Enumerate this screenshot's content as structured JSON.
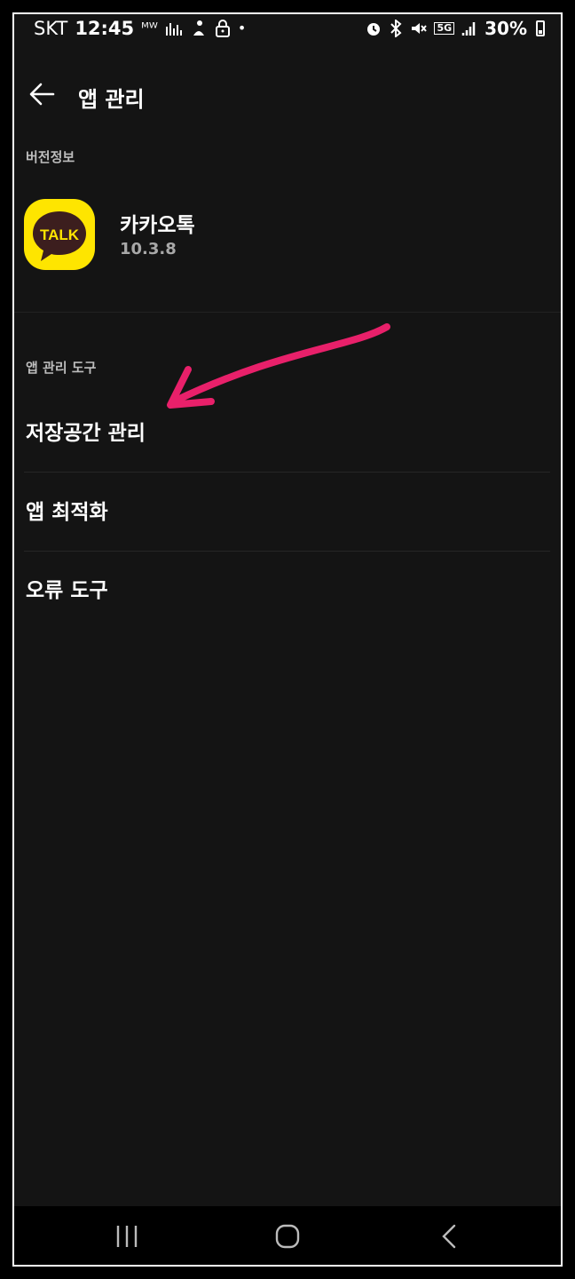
{
  "status_bar": {
    "carrier": "SKT",
    "time": "12:45",
    "battery_percent": "30%",
    "network": "5G",
    "left_icons": [
      "mw-icon",
      "stock-icon",
      "person-icon",
      "lock-icon",
      "dot"
    ],
    "right_icons": [
      "alarm-icon",
      "bluetooth-icon",
      "mute-icon",
      "5g-icon",
      "signal-icon",
      "battery-icon"
    ]
  },
  "header": {
    "title": "앱 관리"
  },
  "version_section": {
    "label": "버전정보",
    "app_name": "카카오톡",
    "app_version": "10.3.8",
    "app_icon_text": "TALK"
  },
  "tools_section": {
    "label": "앱 관리 도구",
    "items": [
      {
        "label": "저장공간 관리"
      },
      {
        "label": "앱 최적화"
      },
      {
        "label": "오류 도구"
      }
    ]
  },
  "colors": {
    "background": "#141414",
    "accent_yellow": "#fee500",
    "annotation_arrow": "#e8206a"
  }
}
